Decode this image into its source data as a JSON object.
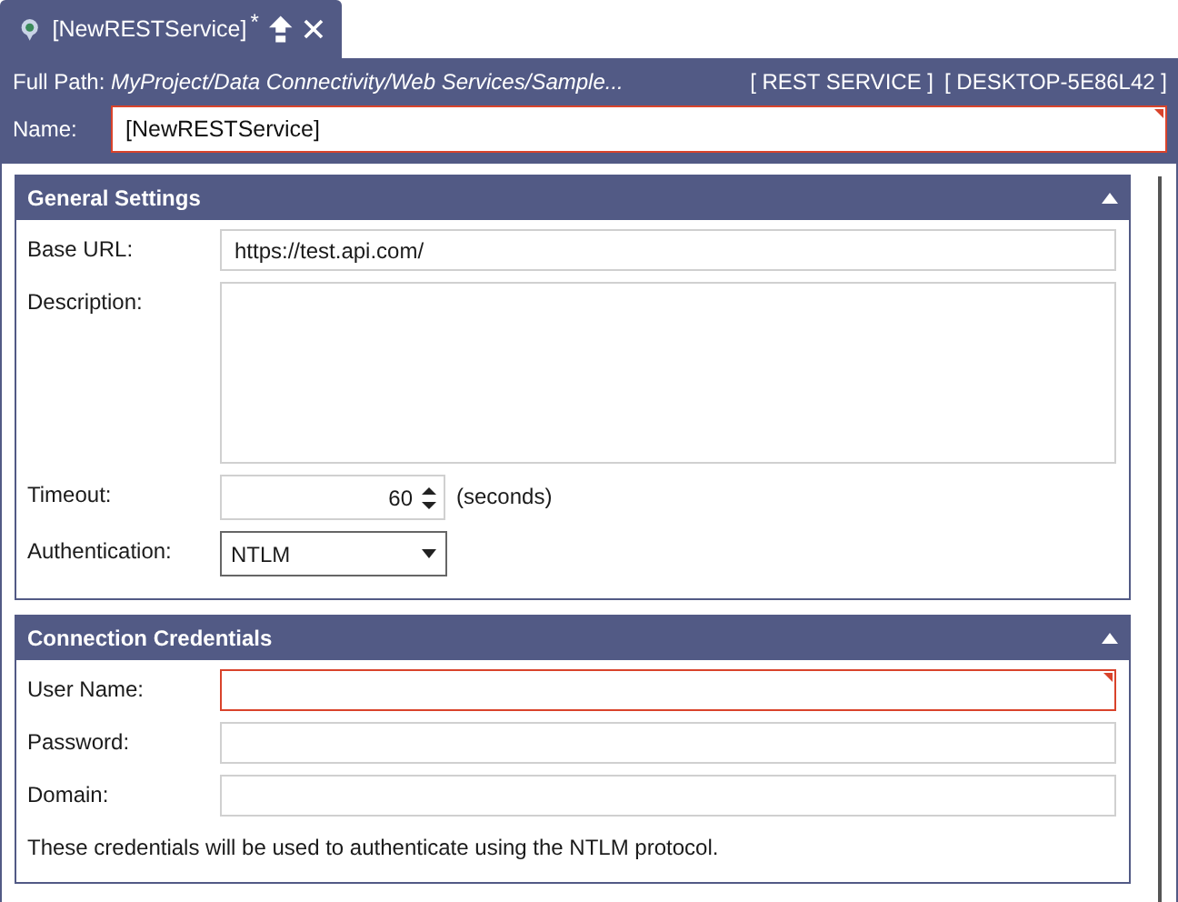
{
  "tab": {
    "title": "[NewRESTService]",
    "modified_mark": "*",
    "selected": true
  },
  "header": {
    "path_label": "Full Path:",
    "path": "MyProject/Data Connectivity/Web Services/Sample...",
    "type": "[ REST SERVICE ]",
    "host": "[ DESKTOP-5E86L42 ]",
    "name_label": "Name:",
    "name": "[NewRESTService]",
    "name_invalid": true
  },
  "sections": [
    {
      "title": "General Settings",
      "expanded": true,
      "fields": [
        {
          "kind": "text",
          "label": "Base URL:",
          "value": "https://test.api.com/",
          "invalid": false
        },
        {
          "kind": "textarea",
          "label": "Description:",
          "invalid": false
        },
        {
          "kind": "spinner",
          "label": "Timeout:",
          "value": "60",
          "unit": "(seconds)",
          "invalid": false
        },
        {
          "kind": "dropdown",
          "label": "Authentication:",
          "value": "NTLM",
          "invalid": false
        }
      ]
    },
    {
      "title": "Connection Credentials",
      "expanded": true,
      "fields": [
        {
          "kind": "text",
          "label": "User Name:",
          "invalid": true
        },
        {
          "kind": "text",
          "label": "Password:",
          "invalid": false
        },
        {
          "kind": "text",
          "label": "Domain:",
          "invalid": false
        }
      ],
      "note": "These credentials will be used to authenticate using the NTLM protocol."
    }
  ]
}
